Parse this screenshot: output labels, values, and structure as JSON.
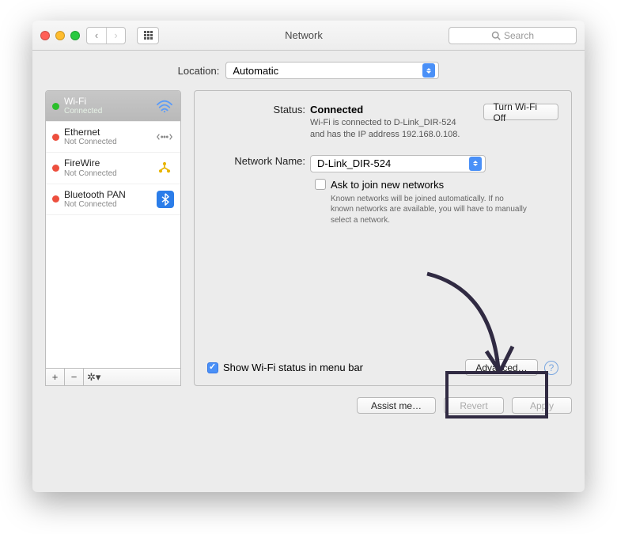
{
  "window_title": "Network",
  "search_placeholder": "Search",
  "location": {
    "label": "Location:",
    "value": "Automatic"
  },
  "sidebar": {
    "items": [
      {
        "name": "Wi-Fi",
        "status": "Connected"
      },
      {
        "name": "Ethernet",
        "status": "Not Connected"
      },
      {
        "name": "FireWire",
        "status": "Not Connected"
      },
      {
        "name": "Bluetooth PAN",
        "status": "Not Connected"
      }
    ]
  },
  "detail": {
    "status_label": "Status:",
    "status_value": "Connected",
    "toggle_button": "Turn Wi-Fi Off",
    "status_desc": "Wi-Fi is connected to D-Link_DIR-524 and has the IP address 192.168.0.108.",
    "network_label": "Network Name:",
    "network_value": "D-Link_DIR-524",
    "ask_join": "Ask to join new networks",
    "ask_join_desc": "Known networks will be joined automatically. If no known networks are available, you will have to manually select a network.",
    "show_status": "Show Wi-Fi status in menu bar",
    "advanced": "Advanced…"
  },
  "footer": {
    "assist": "Assist me…",
    "revert": "Revert",
    "apply": "Apply"
  }
}
